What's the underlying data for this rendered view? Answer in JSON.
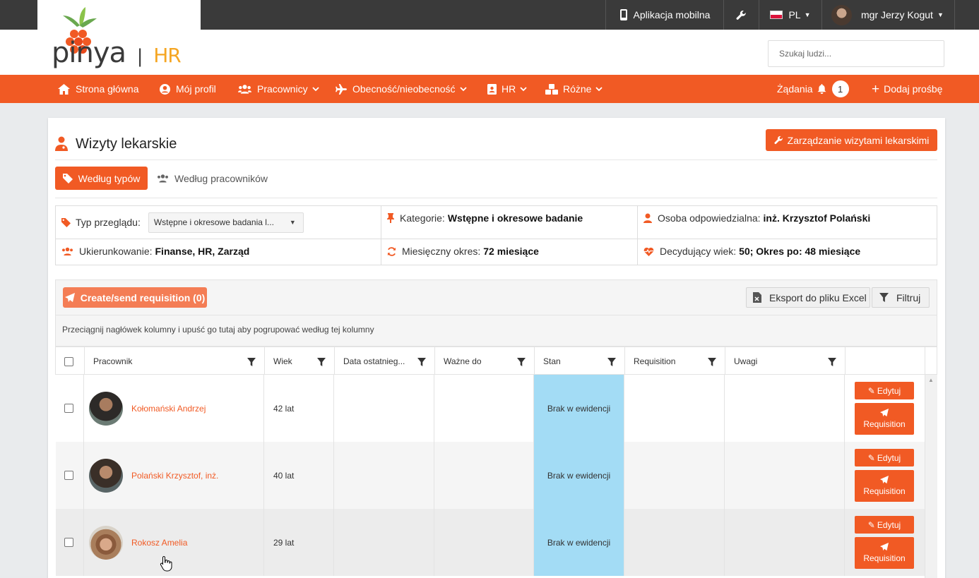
{
  "topbar": {
    "mobile_app": "Aplikacja mobilna",
    "language": "PL",
    "user_name": "mgr Jerzy Kogut"
  },
  "brand": {
    "logo_text": "pinya",
    "logo_suffix": "HR"
  },
  "search": {
    "placeholder": "Szukaj ludzi..."
  },
  "nav": {
    "items": [
      {
        "label": "Strona główna",
        "icon": "home-icon"
      },
      {
        "label": "Mój profil",
        "icon": "user-circle-icon"
      },
      {
        "label": "Pracownicy",
        "icon": "users-icon"
      },
      {
        "label": "Obecność/nieobecność",
        "icon": "plane-icon"
      },
      {
        "label": "HR",
        "icon": "id-card-icon"
      },
      {
        "label": "Różne",
        "icon": "cubes-icon"
      }
    ],
    "requests_label": "Żądania",
    "requests_count": "1",
    "add_request": "Dodaj prośbę"
  },
  "page": {
    "title": "Wizyty lekarskie",
    "manage_button": "Zarządzanie wizytami lekarskimi",
    "tabs": [
      "Według typów",
      "Według pracowników"
    ],
    "active_tab": 0
  },
  "info": {
    "review_type_label": "Typ przeglądu:",
    "review_type_value": "Wstępne i okresowe badania l...",
    "category_label": "Kategorie:",
    "category_value": "Wstępne i okresowe badanie",
    "responsible_label": "Osoba odpowiedzialna:",
    "responsible_value": "inż. Krzysztof Polański",
    "focus_label": "Ukierunkowanie:",
    "focus_value": "Finanse, HR, Zarząd",
    "period_label": "Miesięczny okres:",
    "period_value": "72 miesiące",
    "age_label": "Decydujący wiek:",
    "age_value": "50; Okres po: 48 miesiące"
  },
  "grid": {
    "create_button": "Create/send requisition (0)",
    "export_button": "Eksport do pliku Excel",
    "filter_button": "Filtruj",
    "group_hint": "Przeciągnij nagłówek kolumny i upuść go tutaj aby pogrupować według tej kolumny",
    "columns": [
      "Pracownik",
      "Wiek",
      "Data ostatnieg...",
      "Ważne do",
      "Stan",
      "Requisition",
      "Uwagi"
    ],
    "rows": [
      {
        "name": "Kołomański Andrzej",
        "age": "42 lat",
        "status": "Brak w ewidencji",
        "edit": "Edytuj",
        "requisition": "Requisition"
      },
      {
        "name": "Polański Krzysztof, inż.",
        "age": "40 lat",
        "status": "Brak w ewidencji",
        "edit": "Edytuj",
        "requisition": "Requisition"
      },
      {
        "name": "Rokosz Amelia",
        "age": "29 lat",
        "status": "Brak w ewidencji",
        "edit": "Edytuj",
        "requisition": "Requisition"
      }
    ]
  },
  "colors": {
    "accent": "#f15a24",
    "topbar": "#3a3a3a",
    "status_cell": "#a3dcf5"
  }
}
